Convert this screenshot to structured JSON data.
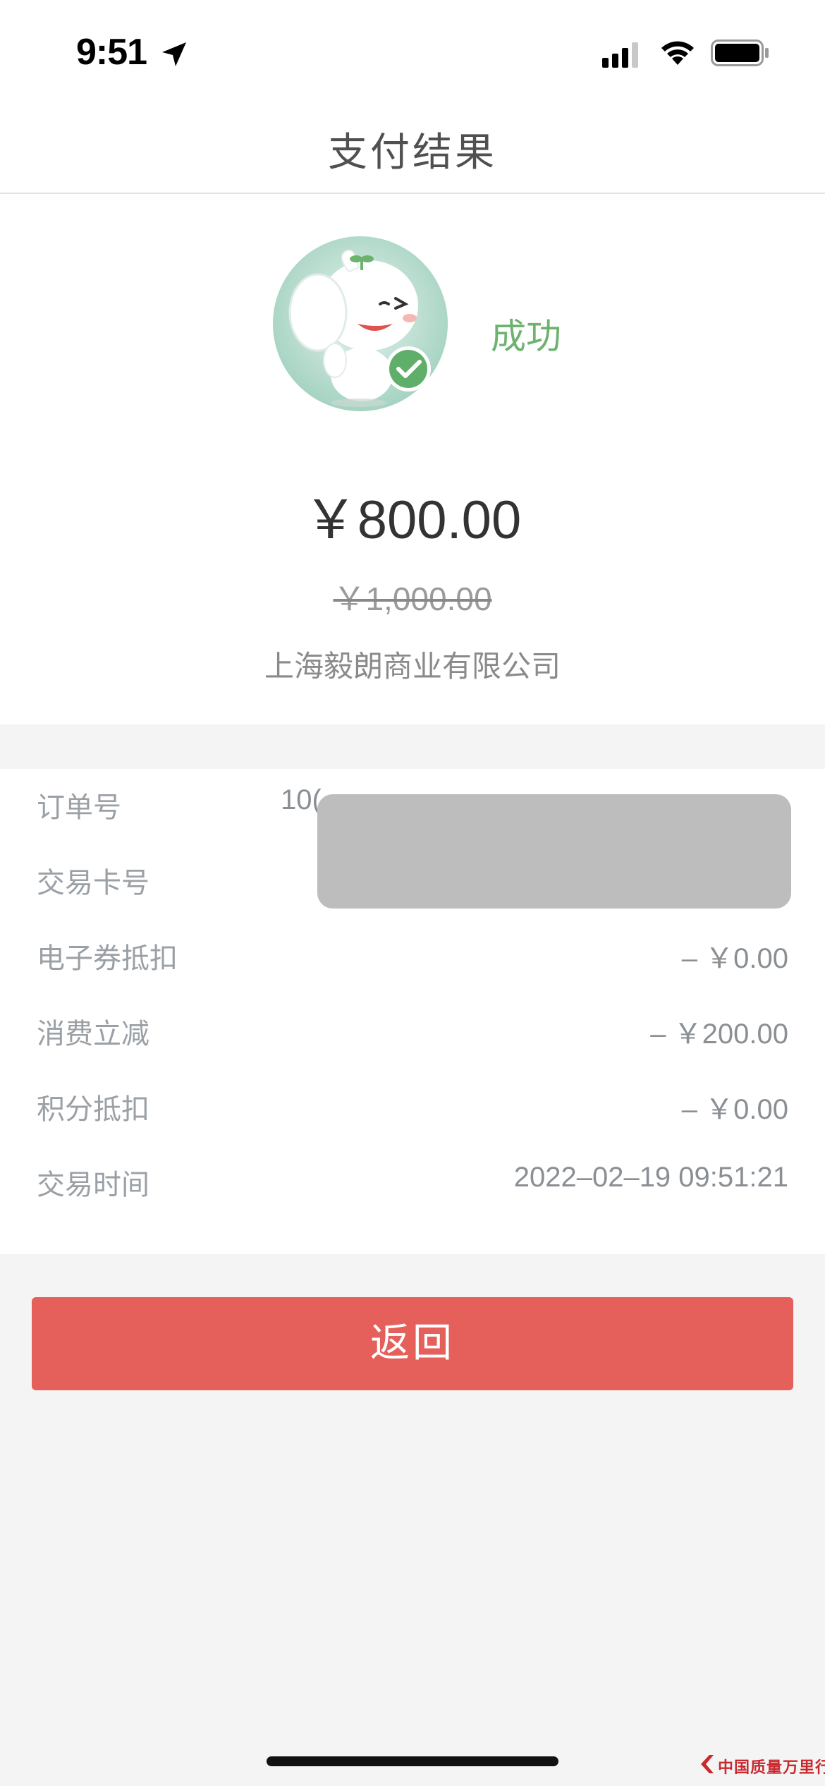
{
  "status_bar": {
    "time": "9:51",
    "location_icon": "location-arrow-icon",
    "signal_icon": "cellular-signal-icon",
    "wifi_icon": "wifi-icon",
    "battery_icon": "battery-icon"
  },
  "nav": {
    "title": "支付结果"
  },
  "result": {
    "avatar_icon": "elephant-mascot-success-icon",
    "status": "成功",
    "amount": "￥800.00",
    "original_amount": "￥1,000.00",
    "merchant": "上海毅朗商业有限公司"
  },
  "details": [
    {
      "label": "订单号",
      "value": "10("
    },
    {
      "label": "交易卡号",
      "value": ""
    },
    {
      "label": "电子券抵扣",
      "value": "– ￥0.00"
    },
    {
      "label": "消费立减",
      "value": "– ￥200.00"
    },
    {
      "label": "积分抵扣",
      "value": "– ￥0.00"
    },
    {
      "label": "交易时间",
      "value": "2022–02–19 09:51:21"
    }
  ],
  "button": {
    "label": "返回"
  },
  "watermark": {
    "text": "中国质量万里行"
  },
  "colors": {
    "success_green": "#6db26f",
    "button_red": "#e5605b",
    "page_bg": "#f4f4f4",
    "redaction_gray": "#bdbdbd"
  }
}
